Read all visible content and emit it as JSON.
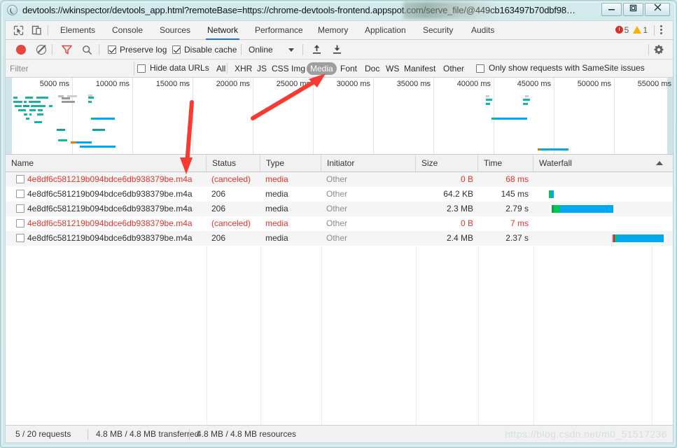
{
  "window": {
    "title": "devtools://wkinspector/devtools_app.html?remoteBase=https://chrome-devtools-frontend.appspot.com/serve_file/@449cb163497b70dbf98…",
    "minimize_label": "—",
    "maximize_label": "❐",
    "close_label": "✕",
    "favicon": "devtools-globe-icon"
  },
  "devtools": {
    "inspect_icon": "inspect-element-icon",
    "device_icon": "device-toolbar-icon",
    "tabs": [
      {
        "label": "Elements",
        "active": false
      },
      {
        "label": "Console",
        "active": false
      },
      {
        "label": "Sources",
        "active": false
      },
      {
        "label": "Network",
        "active": true
      },
      {
        "label": "Performance",
        "active": false
      },
      {
        "label": "Memory",
        "active": false
      },
      {
        "label": "Application",
        "active": false
      },
      {
        "label": "Security",
        "active": false
      },
      {
        "label": "Audits",
        "active": false
      }
    ],
    "error_count": "5",
    "warning_count": "1",
    "more_icon": "kebab-menu-icon"
  },
  "toolbar": {
    "record_icon": "record-button-icon",
    "clear_icon": "clear-button-icon",
    "filter_icon": "filter-funnel-icon",
    "search_icon": "search-icon",
    "preserve_log_label": "Preserve log",
    "preserve_log_checked": true,
    "disable_cache_label": "Disable cache",
    "disable_cache_checked": true,
    "throttling_value": "Online",
    "import_icon": "import-har-icon",
    "export_icon": "export-har-icon",
    "settings_icon": "gear-icon"
  },
  "filterbar": {
    "filter_placeholder": "Filter",
    "filter_value": "",
    "hide_data_urls_label": "Hide data URLs",
    "hide_data_urls_checked": false,
    "types": [
      {
        "label": "All",
        "selected": false
      },
      {
        "label": "XHR",
        "selected": false
      },
      {
        "label": "JS",
        "selected": false
      },
      {
        "label": "CSS",
        "selected": false
      },
      {
        "label": "Img",
        "selected": false
      },
      {
        "label": "Media",
        "selected": true
      },
      {
        "label": "Font",
        "selected": false
      },
      {
        "label": "Doc",
        "selected": false
      },
      {
        "label": "WS",
        "selected": false
      },
      {
        "label": "Manifest",
        "selected": false
      },
      {
        "label": "Other",
        "selected": false
      }
    ],
    "samesite_label": "Only show requests with SameSite issues",
    "samesite_checked": false
  },
  "overview": {
    "ticks": [
      "5000 ms",
      "10000 ms",
      "15000 ms",
      "20000 ms",
      "25000 ms",
      "30000 ms",
      "35000 ms",
      "40000 ms",
      "45000 ms",
      "50000 ms",
      "55000 ms"
    ]
  },
  "table": {
    "columns": [
      {
        "label": "Name"
      },
      {
        "label": "Status"
      },
      {
        "label": "Type"
      },
      {
        "label": "Initiator"
      },
      {
        "label": "Size"
      },
      {
        "label": "Time"
      },
      {
        "label": "Waterfall"
      }
    ],
    "sort_icon": "sort-ascending-icon",
    "rows": [
      {
        "name": "4e8df6c581219b094bdce6db938379be.m4a",
        "status": "(canceled)",
        "type": "media",
        "initiator": "Other",
        "size": "0 B",
        "time": "68 ms",
        "error": true
      },
      {
        "name": "4e8df6c581219b094bdce6db938379be.m4a",
        "status": "206",
        "type": "media",
        "initiator": "Other",
        "size": "64.2 KB",
        "time": "145 ms",
        "error": false
      },
      {
        "name": "4e8df6c581219b094bdce6db938379be.m4a",
        "status": "206",
        "type": "media",
        "initiator": "Other",
        "size": "2.3 MB",
        "time": "2.79 s",
        "error": false
      },
      {
        "name": "4e8df6c581219b094bdce6db938379be.m4a",
        "status": "(canceled)",
        "type": "media",
        "initiator": "Other",
        "size": "0 B",
        "time": "7 ms",
        "error": true
      },
      {
        "name": "4e8df6c581219b094bdce6db938379be.m4a",
        "status": "206",
        "type": "media",
        "initiator": "Other",
        "size": "2.4 MB",
        "time": "2.37 s",
        "error": false
      }
    ]
  },
  "statusbar": {
    "requests": "5 / 20 requests",
    "transferred": "4.8 MB / 4.8 MB transferred",
    "resources": "4.8 MB / 4.8 MB resources",
    "watermark": "https://blog.csdn.net/m0_51517236"
  },
  "annotations": {
    "arrow_to_media_filter": "red-arrow-icon",
    "arrow_to_name_column": "red-arrow-icon",
    "color": "#f83a30"
  },
  "colors": {
    "accent": "#1a73e8",
    "error": "#e4342a",
    "waterfall_download": "#00a8f0",
    "waterfall_wait": "#00c853",
    "frame": "#cfe7ea"
  }
}
